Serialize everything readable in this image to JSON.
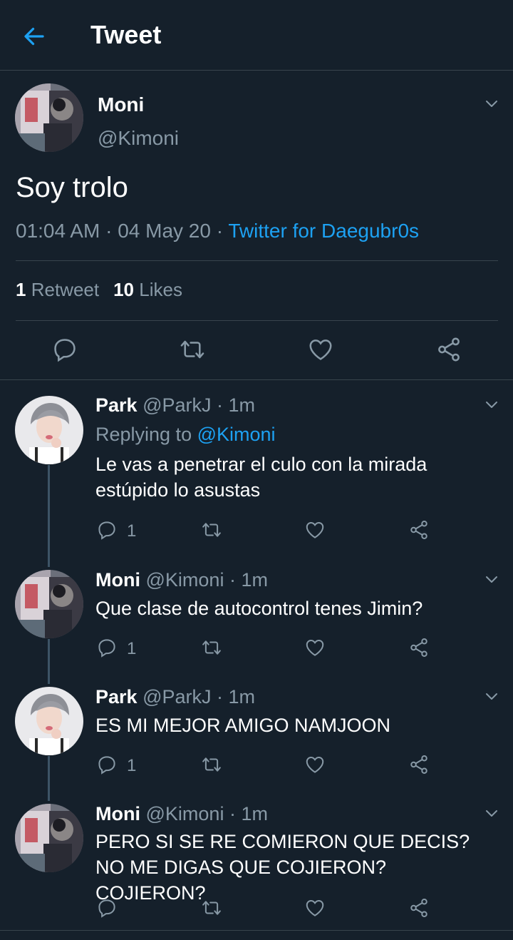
{
  "header": {
    "title": "Tweet",
    "back_icon": "arrow-left-icon"
  },
  "tweet": {
    "name": "Moni",
    "handle": "@Kimoni",
    "text": "Soy trolo",
    "time": "01:04 AM",
    "date": "04 May 20",
    "separator": "·",
    "source": "Twitter for Daegubr0s",
    "retweets_count": "1",
    "retweets_label": "Retweet",
    "likes_count": "10",
    "likes_label": "Likes"
  },
  "replies": [
    {
      "name": "Park",
      "handle": "@ParkJ",
      "time": "· 1m",
      "replying_prefix": "Replying to ",
      "replying_to": "@Kimoni",
      "text": "Le vas a penetrar el culo con la mirada estúpido lo asustas",
      "reply_count": "1"
    },
    {
      "name": "Moni",
      "handle": "@Kimoni",
      "time": "· 1m",
      "text": "Que clase de autocontrol tenes Jimin?",
      "reply_count": "1"
    },
    {
      "name": "Park",
      "handle": "@ParkJ",
      "time": "· 1m",
      "text": "ES MI MEJOR AMIGO NAMJOON",
      "reply_count": "1"
    },
    {
      "name": "Moni",
      "handle": "@Kimoni",
      "time": "· 1m",
      "text": "PERO SI SE RE COMIERON QUE DECIS? NO ME DIGAS QUE COJIERON? COJIERON?",
      "reply_count": ""
    }
  ],
  "colors": {
    "background": "#15202b",
    "accent": "#1da1f2",
    "secondary_text": "#8899a6",
    "divider": "#38444d"
  }
}
